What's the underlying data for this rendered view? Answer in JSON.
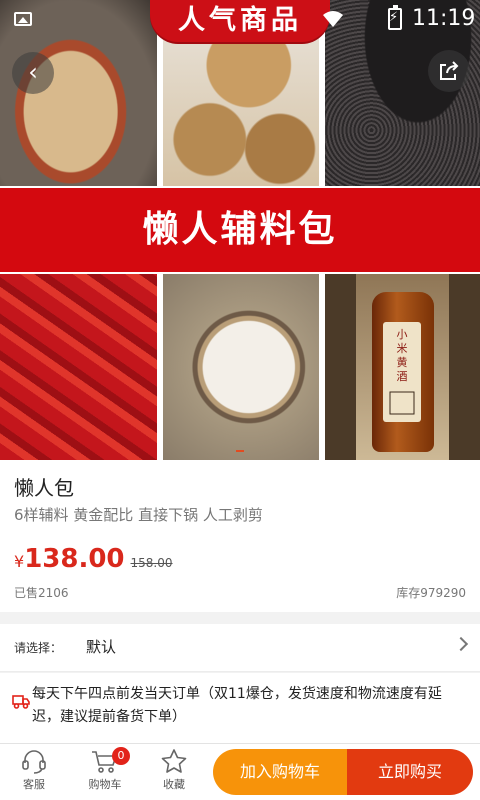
{
  "status_bar": {
    "time": "11:19"
  },
  "hero": {
    "top_badge": "人气商品",
    "band_text": "懒人辅料包",
    "bottle_label": "小米黄酒"
  },
  "product": {
    "name": "懒人包",
    "subtitle": "6样辅料 黄金配比 直接下锅 人工剥剪",
    "currency": "¥",
    "price": "138.00",
    "original_price": "158.00",
    "sold": "已售2106",
    "stock": "库存979290"
  },
  "options": {
    "label": "请选择：",
    "value": "默认"
  },
  "shipping": {
    "text": "每天下午四点前发当天订单（双11爆仓，发货速度和物流速度有延迟，建议提前备货下单）"
  },
  "bottom_bar": {
    "service": "客服",
    "cart": "购物车",
    "cart_count": "0",
    "favorite": "收藏",
    "add_to_cart": "加入购物车",
    "buy_now": "立即购买"
  },
  "colors": {
    "brand_red": "#d4090f",
    "price_red": "#d9281c",
    "cart_orange": "#f7930a",
    "buy_red": "#e23a10"
  }
}
